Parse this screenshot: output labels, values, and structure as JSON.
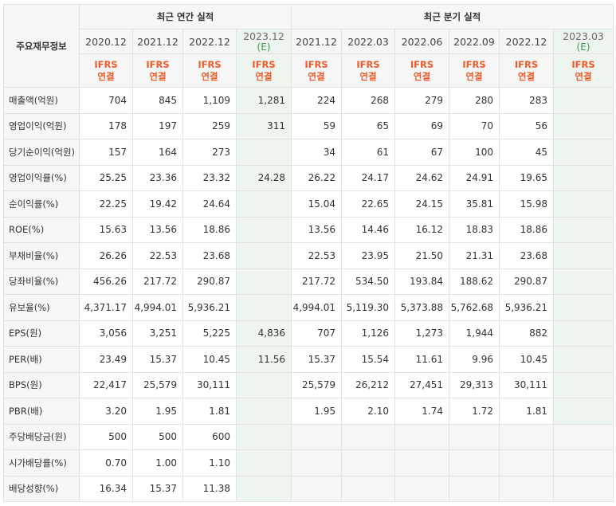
{
  "corner_label": "주요재무정보",
  "groups": {
    "annual": "최근 연간 실적",
    "quarterly": "최근 분기 실적"
  },
  "periods": [
    {
      "label": "2020.12",
      "est": "",
      "ifrs": "IFRS",
      "basis": "연결"
    },
    {
      "label": "2021.12",
      "est": "",
      "ifrs": "IFRS",
      "basis": "연결"
    },
    {
      "label": "2022.12",
      "est": "",
      "ifrs": "IFRS",
      "basis": "연결"
    },
    {
      "label": "2023.12",
      "est": "(E)",
      "ifrs": "IFRS",
      "basis": "연결"
    },
    {
      "label": "2021.12",
      "est": "",
      "ifrs": "IFRS",
      "basis": "연결"
    },
    {
      "label": "2022.03",
      "est": "",
      "ifrs": "IFRS",
      "basis": "연결"
    },
    {
      "label": "2022.06",
      "est": "",
      "ifrs": "IFRS",
      "basis": "연결"
    },
    {
      "label": "2022.09",
      "est": "",
      "ifrs": "IFRS",
      "basis": "연결"
    },
    {
      "label": "2022.12",
      "est": "",
      "ifrs": "IFRS",
      "basis": "연결"
    },
    {
      "label": "2023.03",
      "est": "(E)",
      "ifrs": "IFRS",
      "basis": "연결"
    }
  ],
  "rows": [
    {
      "label": "매출액(억원)",
      "values": [
        "704",
        "845",
        "1,109",
        "1,281",
        "224",
        "268",
        "279",
        "280",
        "283",
        ""
      ]
    },
    {
      "label": "영업이익(억원)",
      "values": [
        "178",
        "197",
        "259",
        "311",
        "59",
        "65",
        "69",
        "70",
        "56",
        ""
      ]
    },
    {
      "label": "당기순이익(억원)",
      "values": [
        "157",
        "164",
        "273",
        "",
        "34",
        "61",
        "67",
        "100",
        "45",
        ""
      ]
    },
    {
      "label": "영업이익률(%)",
      "values": [
        "25.25",
        "23.36",
        "23.32",
        "24.28",
        "26.22",
        "24.17",
        "24.62",
        "24.91",
        "19.65",
        ""
      ]
    },
    {
      "label": "순이익률(%)",
      "values": [
        "22.25",
        "19.42",
        "24.64",
        "",
        "15.04",
        "22.65",
        "24.15",
        "35.81",
        "15.98",
        ""
      ]
    },
    {
      "label": "ROE(%)",
      "values": [
        "15.63",
        "13.56",
        "18.86",
        "",
        "13.56",
        "14.46",
        "16.12",
        "18.83",
        "18.86",
        ""
      ]
    },
    {
      "label": "부채비율(%)",
      "values": [
        "26.26",
        "22.53",
        "23.68",
        "",
        "22.53",
        "23.95",
        "21.50",
        "21.31",
        "23.68",
        ""
      ]
    },
    {
      "label": "당좌비율(%)",
      "values": [
        "456.26",
        "217.72",
        "290.87",
        "",
        "217.72",
        "534.50",
        "193.84",
        "188.62",
        "290.87",
        ""
      ]
    },
    {
      "label": "유보율(%)",
      "values": [
        "4,371.17",
        "4,994.01",
        "5,936.21",
        "",
        "4,994.01",
        "5,119.30",
        "5,373.88",
        "5,762.68",
        "5,936.21",
        ""
      ]
    },
    {
      "label": "EPS(원)",
      "values": [
        "3,056",
        "3,251",
        "5,225",
        "4,836",
        "707",
        "1,126",
        "1,273",
        "1,944",
        "882",
        ""
      ]
    },
    {
      "label": "PER(배)",
      "values": [
        "23.49",
        "15.37",
        "10.45",
        "11.56",
        "15.37",
        "15.54",
        "11.61",
        "9.96",
        "10.45",
        ""
      ]
    },
    {
      "label": "BPS(원)",
      "values": [
        "22,417",
        "25,579",
        "30,111",
        "",
        "25,579",
        "26,212",
        "27,451",
        "29,313",
        "30,111",
        ""
      ]
    },
    {
      "label": "PBR(배)",
      "values": [
        "3.20",
        "1.95",
        "1.81",
        "",
        "1.95",
        "2.10",
        "1.74",
        "1.72",
        "1.81",
        ""
      ]
    },
    {
      "label": "주당배당금(원)",
      "values": [
        "500",
        "500",
        "600",
        "",
        "",
        "",
        "",
        "",
        "",
        ""
      ]
    },
    {
      "label": "시가배당률(%)",
      "values": [
        "0.70",
        "1.00",
        "1.10",
        "",
        "",
        "",
        "",
        "",
        "",
        ""
      ]
    },
    {
      "label": "배당성향(%)",
      "values": [
        "16.34",
        "15.37",
        "11.38",
        "",
        "",
        "",
        "",
        "",
        "",
        ""
      ]
    }
  ],
  "group_breaks": [
    3,
    6,
    9,
    13
  ],
  "colors": {
    "ifrs": "#f05a28",
    "estimate_bg": "#eef5ef",
    "estimate_text": "#3a9a50",
    "header_bg": "#f6f6f6"
  }
}
